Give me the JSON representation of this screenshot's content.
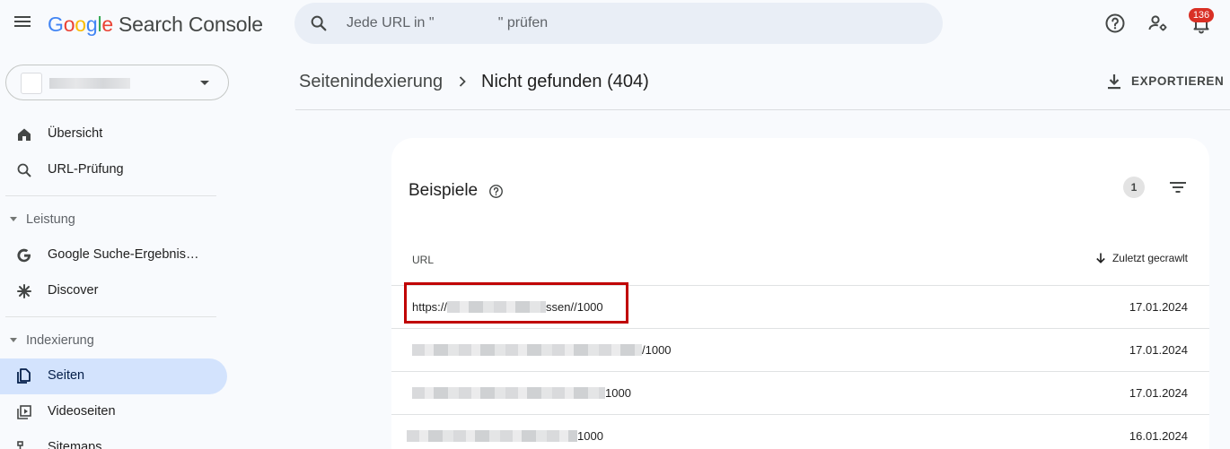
{
  "header": {
    "logo_letters": [
      "G",
      "o",
      "o",
      "g",
      "l",
      "e"
    ],
    "product": "Search Console",
    "search_placeholder": "Jede URL in \"                \" prüfen",
    "notification_count": "136",
    "icons": [
      "menu-icon",
      "search-icon",
      "help-icon",
      "manage-users-icon",
      "notifications-icon"
    ]
  },
  "sidebar": {
    "property_selector": "",
    "items": [
      {
        "label": "Übersicht",
        "icon": "home-icon"
      },
      {
        "label": "URL-Prüfung",
        "icon": "search-icon"
      }
    ],
    "sections": [
      {
        "label": "Leistung",
        "items": [
          {
            "label": "Google Suche-Ergebnis…",
            "icon": "google-g-icon"
          },
          {
            "label": "Discover",
            "icon": "asterisk-icon"
          }
        ]
      },
      {
        "label": "Indexierung",
        "items": [
          {
            "label": "Seiten",
            "icon": "pages-icon",
            "active": true
          },
          {
            "label": "Videoseiten",
            "icon": "video-pages-icon"
          },
          {
            "label": "Sitemaps",
            "icon": "sitemap-icon"
          }
        ]
      }
    ]
  },
  "breadcrumb": {
    "parent": "Seitenindexierung",
    "current": "Nicht gefunden (404)"
  },
  "export_label": "EXPORTIEREN",
  "card": {
    "title": "Beispiele",
    "filter_count": "1",
    "columns": {
      "url": "URL",
      "last_crawled": "Zuletzt gecrawlt"
    },
    "rows": [
      {
        "url_prefix": "https://",
        "url_suffix": "ssen//1000",
        "date": "17.01.2024"
      },
      {
        "url_prefix": "",
        "url_suffix": "/1000",
        "date": "17.01.2024"
      },
      {
        "url_prefix": "",
        "url_suffix": "1000",
        "date": "17.01.2024"
      },
      {
        "url_prefix": "",
        "url_suffix": "1000",
        "date": "16.01.2024"
      }
    ]
  },
  "colors": {
    "accent": "#d3e3fd",
    "highlight": "#c00000",
    "badge": "#d93025"
  }
}
